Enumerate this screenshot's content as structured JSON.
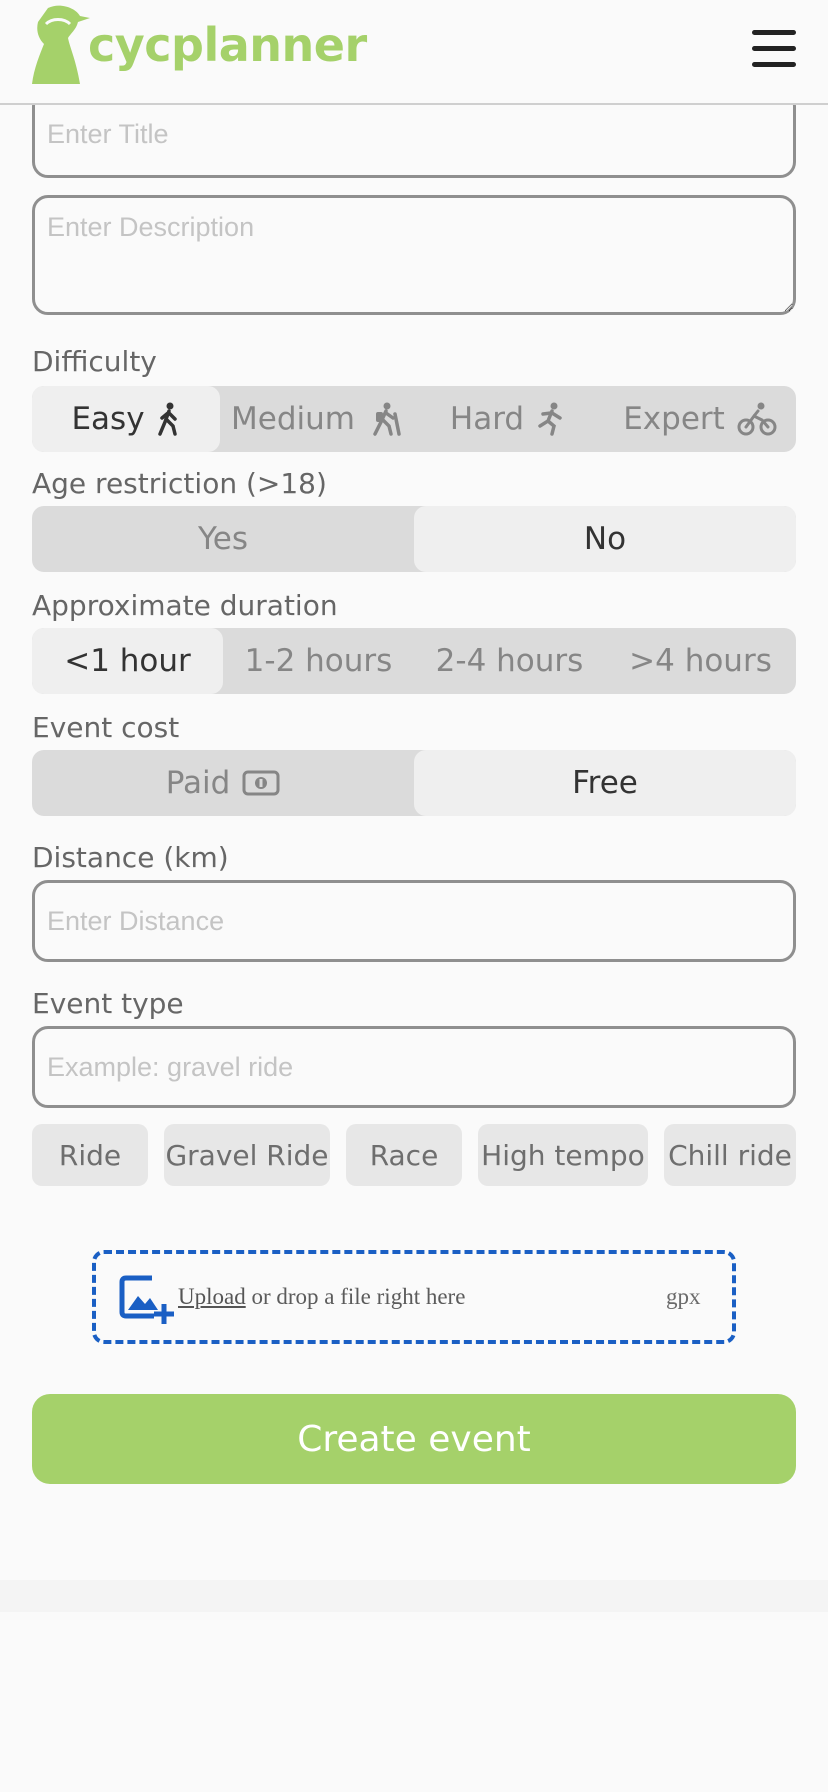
{
  "header": {
    "brand": "cycplanner",
    "brand_color": "#a5d16a",
    "menu_icon": "hamburger-menu-icon"
  },
  "form": {
    "title_placeholder": "Enter Title",
    "description_placeholder": "Enter Description",
    "difficulty": {
      "label": "Difficulty",
      "options": [
        "Easy",
        "Medium",
        "Hard",
        "Expert"
      ],
      "icons": [
        "walking-icon",
        "hiking-icon",
        "running-icon",
        "bicycle-icon"
      ],
      "selected": "Easy"
    },
    "age_restriction": {
      "label": "Age restriction (>18)",
      "options": [
        "Yes",
        "No"
      ],
      "selected": "No"
    },
    "duration": {
      "label": "Approximate duration",
      "options": [
        "<1 hour",
        "1-2 hours",
        "2-4 hours",
        ">4 hours"
      ],
      "selected": "<1 hour"
    },
    "cost": {
      "label": "Event cost",
      "options": [
        "Paid",
        "Free"
      ],
      "paid_icon": "money-bill-icon",
      "selected": "Free"
    },
    "distance": {
      "label": "Distance (km)",
      "placeholder": "Enter Distance"
    },
    "event_type": {
      "label": "Event type",
      "placeholder": "Example: gravel ride",
      "suggestions": [
        "Ride",
        "Gravel Ride",
        "Race",
        "High tempo",
        "Chill ride"
      ]
    },
    "upload": {
      "icon": "add-image-icon",
      "link_text": "Upload",
      "text": " or drop a file right here",
      "file_type": "gpx",
      "border_color": "#1a5fc4"
    },
    "submit_label": "Create event"
  }
}
